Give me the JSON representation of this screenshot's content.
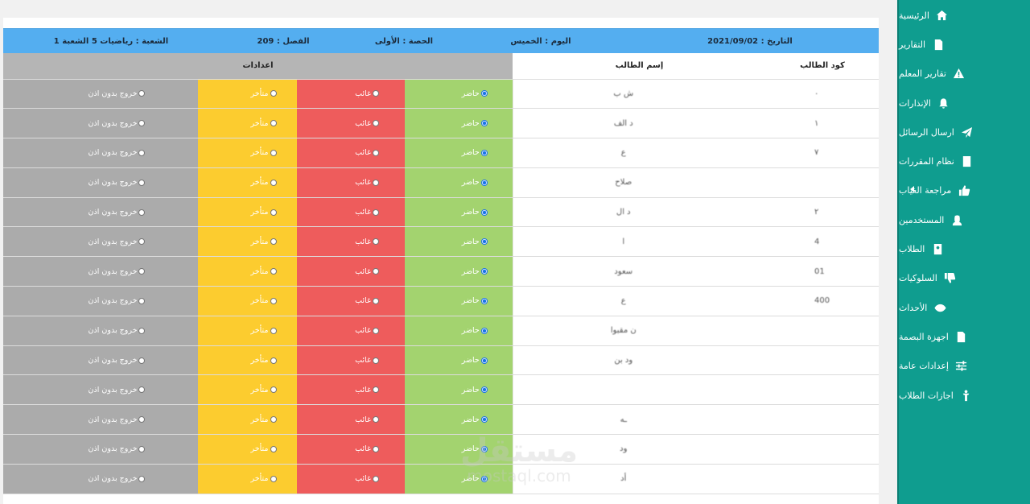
{
  "sidebar": {
    "items": [
      {
        "label": "الرئيسية",
        "icon": "home-icon"
      },
      {
        "label": "التقارير",
        "icon": "report-icon"
      },
      {
        "label": "تقارير المعلم",
        "icon": "warning-icon"
      },
      {
        "label": "الإنذارات",
        "icon": "bell-icon"
      },
      {
        "label": "ارسال الرسائل",
        "icon": "send-icon"
      },
      {
        "label": "نظام المقررات",
        "icon": "book-icon"
      },
      {
        "label": "مراجعة الغياب",
        "icon": "thumbs-up-icon",
        "has_submenu": true
      },
      {
        "label": "المستخدمين",
        "icon": "users-icon"
      },
      {
        "label": "الطلاب",
        "icon": "student-card-icon"
      },
      {
        "label": "السلوكيات",
        "icon": "thumbs-down-icon"
      },
      {
        "label": "الأحداث",
        "icon": "eye-icon"
      },
      {
        "label": "اجهزة البصمة",
        "icon": "fingerprint-device-icon"
      },
      {
        "label": "إعدادات عامة",
        "icon": "sliders-icon"
      },
      {
        "label": "اجازات الطلاب",
        "icon": "person-icon"
      }
    ]
  },
  "header": {
    "date": "التاريخ : 2021/09/02",
    "day": "اليوم : الخميس",
    "period": "الحصة : الأولى",
    "classroom": "الفصل : 209",
    "section": "الشعبة : رياضيات 5 الشعبة 1"
  },
  "table": {
    "col_code": "كود الطالب",
    "col_name": "إسم الطالب",
    "col_settings": "اعدادات",
    "opt_present": "حاضر",
    "opt_absent": "غائب",
    "opt_late": "متأخر",
    "opt_exit": "خروج بدون اذن",
    "rows": [
      {
        "code": "٠",
        "name": "ش ب"
      },
      {
        "code": "١",
        "name": "د الف"
      },
      {
        "code": "٧",
        "name": "ع"
      },
      {
        "code": "",
        "name": "صلاح"
      },
      {
        "code": "٢",
        "name": "د ال"
      },
      {
        "code": "4",
        "name": "ا"
      },
      {
        "code": "01",
        "name": "سعود"
      },
      {
        "code": "400",
        "name": "ع"
      },
      {
        "code": "",
        "name": "ن مقبوا"
      },
      {
        "code": "",
        "name": "ود بن"
      },
      {
        "code": "",
        "name": ""
      },
      {
        "code": "",
        "name": "ـه"
      },
      {
        "code": "",
        "name": "ود"
      },
      {
        "code": "",
        "name": "أد"
      }
    ]
  },
  "watermark": {
    "arabic": "مستقل",
    "latin": "mostaql.com"
  }
}
